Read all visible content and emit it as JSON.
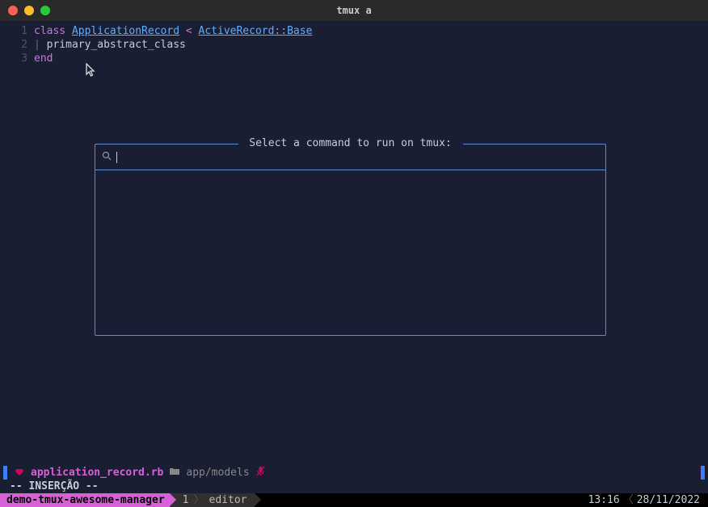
{
  "window": {
    "title": "tmux a"
  },
  "editor": {
    "lines": [
      {
        "num": "1",
        "kw": "class ",
        "cls": "ApplicationRecord",
        "lt": " < ",
        "base": "ActiveRecord::Base"
      },
      {
        "num": "2",
        "pipe": "| ",
        "ident": "primary_abstract_class"
      },
      {
        "num": "3",
        "end": "end"
      }
    ]
  },
  "modal": {
    "title": " Select a command to run on tmux: ",
    "search_value": ""
  },
  "status": {
    "file_name": "application_record.rb",
    "folder": "app/models",
    "mode": "-- INSERÇÃO --"
  },
  "tmux": {
    "session": "demo-tmux-awesome-manager",
    "window_index": "1",
    "window_name": "editor",
    "time": "13:16",
    "date": "28/11/2022"
  }
}
